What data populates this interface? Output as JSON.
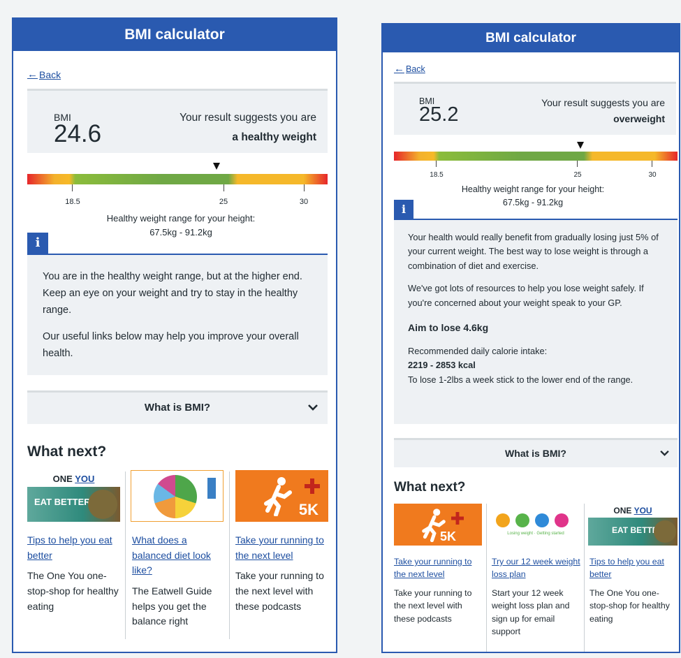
{
  "left": {
    "title": "BMI calculator",
    "back": "Back",
    "bmi_label": "BMI",
    "bmi_value": "24.6",
    "suggest_line": "Your result suggests you are",
    "suggest_result": "a healthy weight",
    "ticks": [
      "18.5",
      "25",
      "30"
    ],
    "range_label": "Healthy weight range for your height:",
    "range_value": "67.5kg - 91.2kg",
    "info_icon": "i",
    "info_p1": "You are in the healthy weight range, but at the higher end. Keep an eye on your weight and try to stay in the healthy range.",
    "info_p2": "Our useful links below may help you improve your overall health.",
    "what_bmi": "What is BMI?",
    "what_next": "What next?",
    "cards": [
      {
        "link": "Tips to help you eat better",
        "desc": "The One You one-stop-shop for healthy eating",
        "logo_one": "ONE",
        "logo_you": "YOU",
        "banner": "EAT BETTER"
      },
      {
        "link": "What does a balanced diet look like?",
        "desc": "The Eatwell Guide helps you get the balance right"
      },
      {
        "link": "Take your running to the next level",
        "desc": "Take your running to the next level with these podcasts",
        "badge": "5K"
      }
    ]
  },
  "right": {
    "title": "BMI calculator",
    "back": "Back",
    "bmi_label": "BMI",
    "bmi_value": "25.2",
    "suggest_line": "Your result suggests you are",
    "suggest_result": "overweight",
    "ticks": [
      "18.5",
      "25",
      "30"
    ],
    "range_label": "Healthy weight range for your height:",
    "range_value": "67.5kg - 91.2kg",
    "info_icon": "i",
    "info_p1": "Your health would really benefit from gradually losing just 5% of your current weight. The best way to lose weight is through a combination of diet and exercise.",
    "info_p2": "We've got lots of resources to help you lose weight safely. If you're concerned about your weight speak to your GP.",
    "aim": "Aim to lose 4.6kg",
    "cal_label": "Recommended daily calorie intake:",
    "cal_value": "2219 - 2853 kcal",
    "cal_note": "To lose 1-2lbs a week stick to the lower end of the range.",
    "what_bmi": "What is BMI?",
    "what_next": "What next?",
    "cards": [
      {
        "link": "Take your running to the next level",
        "desc": "Take your running to the next level with these podcasts",
        "badge": "5K"
      },
      {
        "link": "Try our 12 week weight loss plan",
        "desc": "Start your 12 week weight loss plan and sign up for email support",
        "caption": "Losing weight · Getting started"
      },
      {
        "link": "Tips to help you eat better",
        "desc": "The One You one-stop-shop for healthy eating",
        "logo_one": "ONE",
        "logo_you": "YOU",
        "banner": "EAT BETTER"
      }
    ]
  },
  "colors": {
    "nhs_blue": "#2a5ab0",
    "link": "#1d4ea0",
    "panel_grey": "#eef1f4",
    "orange": "#f07a1e"
  }
}
